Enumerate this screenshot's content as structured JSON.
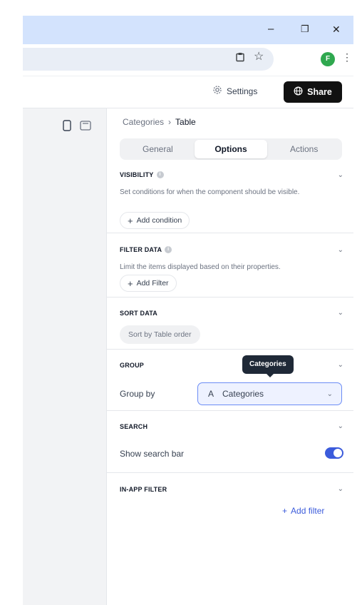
{
  "window": {
    "minimize_glyph": "–",
    "restore_glyph": "❐",
    "close_glyph": "✕"
  },
  "addressbar": {
    "avatar_letter": "F",
    "kebab_glyph": "⋮",
    "bookmark_glyph": "☆",
    "clipboard_glyph": "📋"
  },
  "toolbar": {
    "settings_label": "Settings",
    "share_label": "Share"
  },
  "panel": {
    "breadcrumb": {
      "parent": "Categories",
      "separator": "›",
      "current": "Table"
    },
    "tabs": [
      {
        "label": "General",
        "active": false
      },
      {
        "label": "Options",
        "active": true
      },
      {
        "label": "Actions",
        "active": false
      }
    ],
    "visibility": {
      "title": "VISIBILITY",
      "description": "Set conditions for when the component should be visible.",
      "button_label": "Add condition"
    },
    "filter_data": {
      "title": "FILTER DATA",
      "description": "Limit the items displayed based on their properties.",
      "button_label": "Add Filter"
    },
    "sort_data": {
      "title": "SORT DATA",
      "button_label": "Sort by Table order"
    },
    "group": {
      "title": "GROUP",
      "tooltip": "Categories",
      "field_label": "Group by",
      "select_type_glyph": "A",
      "select_value": "Categories"
    },
    "search": {
      "title": "SEARCH",
      "toggle_label": "Show search bar",
      "toggle_on": true
    },
    "in_app_filter": {
      "title": "IN-APP FILTER",
      "link_label": "Add filter"
    }
  },
  "colors": {
    "accent": "#3b5bdb",
    "titlebar": "#d3e3fd",
    "share_bg": "#111111"
  }
}
